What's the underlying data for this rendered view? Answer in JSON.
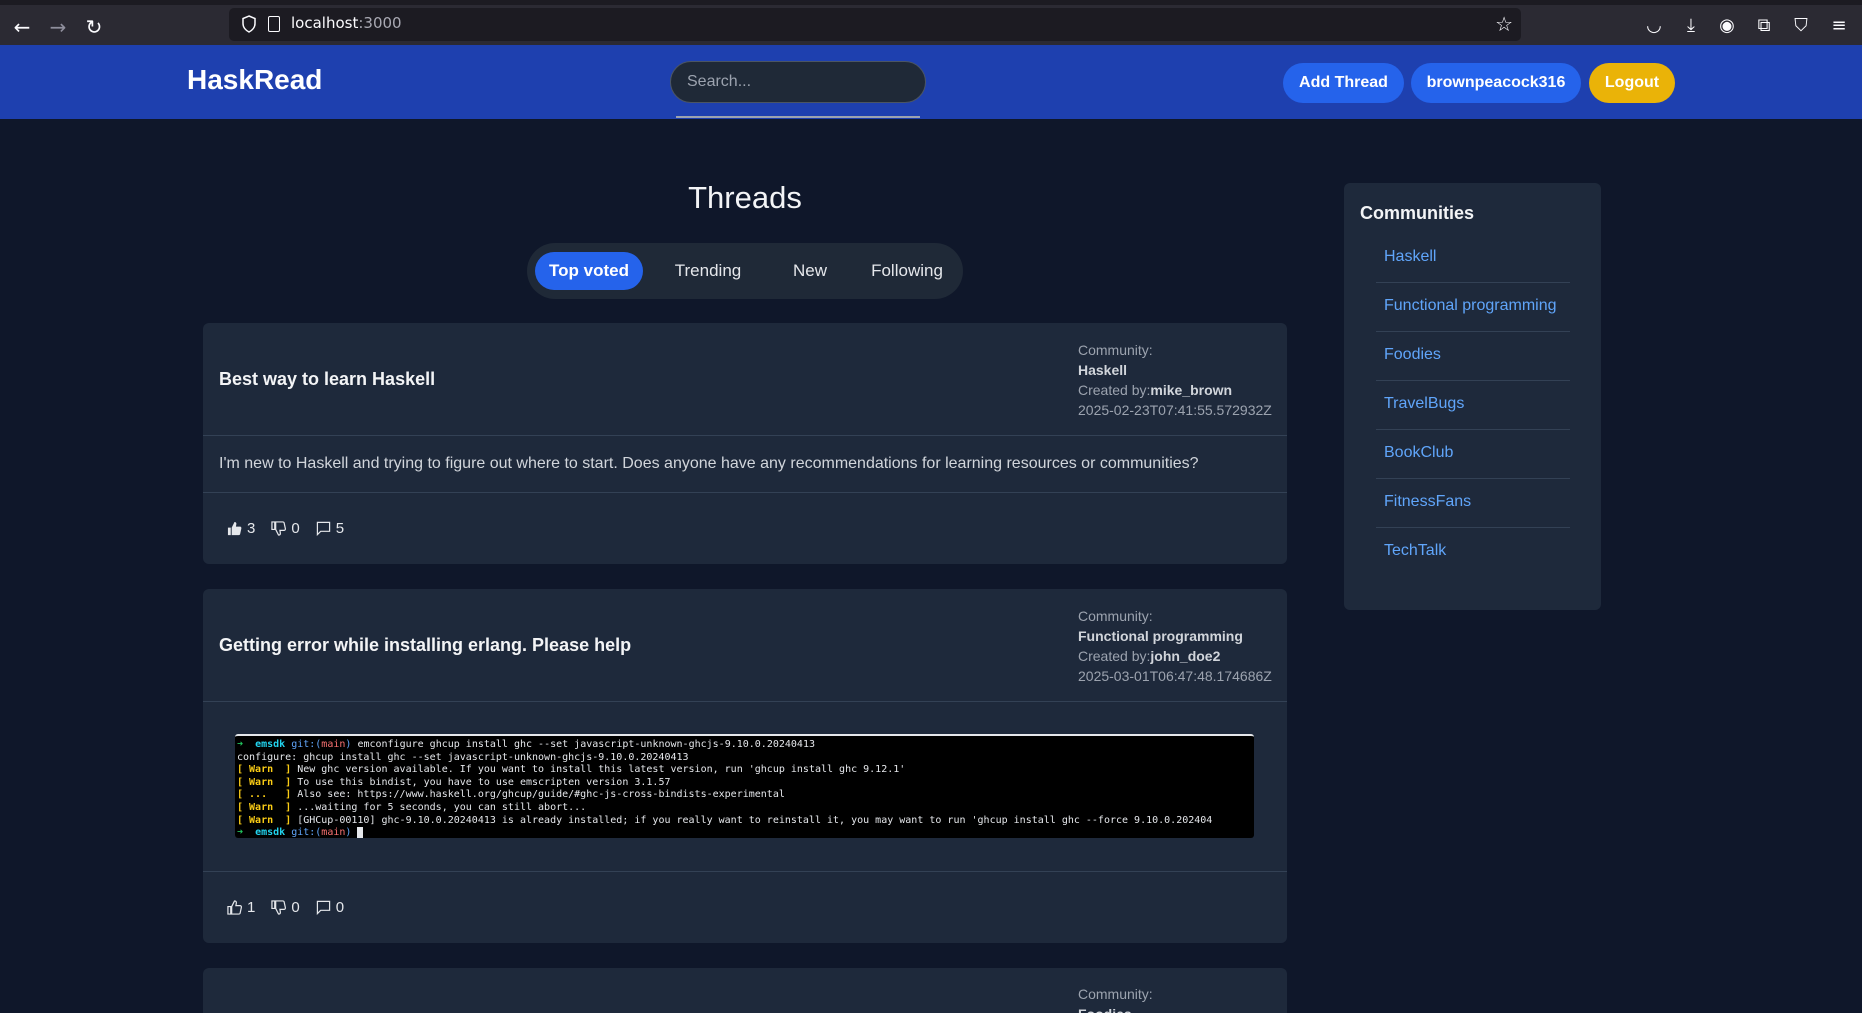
{
  "browser": {
    "url_host": "localhost",
    "url_port": ":3000"
  },
  "header": {
    "logo": "HaskRead",
    "search_placeholder": "Search...",
    "add_thread": "Add Thread",
    "username": "brownpeacock316",
    "logout": "Logout"
  },
  "main": {
    "title": "Threads",
    "tabs": [
      {
        "label": "Top voted",
        "active": true
      },
      {
        "label": "Trending"
      },
      {
        "label": "New"
      },
      {
        "label": "Following"
      }
    ],
    "meta_labels": {
      "community": "Community:",
      "created_by": "Created by:"
    },
    "threads": [
      {
        "title": "Best way to learn Haskell",
        "community": "Haskell",
        "author": "mike_brown",
        "timestamp": "2025-02-23T07:41:55.572932Z",
        "body": "I'm new to Haskell and trying to figure out where to start. Does anyone have any recommendations for learning resources or communities?",
        "upvotes": "3",
        "downvotes": "0",
        "comments": "5"
      },
      {
        "title": "Getting error while installing erlang. Please help",
        "community": "Functional programming",
        "author": "john_doe2",
        "timestamp": "2025-03-01T06:47:48.174686Z",
        "terminal": [
          {
            "prompt": "➜  ",
            "dir": "emsdk ",
            "git": "git:(",
            "branch": "main",
            "close": ") ",
            "text": "emconfigure ghcup install ghc --set javascript-unknown-ghcjs-9.10.0.20240413"
          },
          {
            "text": "configure: ghcup install ghc --set javascript-unknown-ghcjs-9.10.0.20240413"
          },
          {
            "tag": "[ Warn  ]",
            "text": " New ghc version available. If you want to install this latest version, run 'ghcup install ghc 9.12.1'"
          },
          {
            "tag": "[ Warn  ]",
            "text": " To use this bindist, you have to use emscripten version 3.1.57"
          },
          {
            "tag": "[ ...   ]",
            "text": " Also see: https://www.haskell.org/ghcup/guide/#ghc-js-cross-bindists-experimental"
          },
          {
            "tag": "[ Warn  ]",
            "text": " ...waiting for 5 seconds, you can still abort..."
          },
          {
            "tag": "[ Warn  ]",
            "text": " [GHCup-00110] ghc-9.10.0.20240413 is already installed; if you really want to reinstall it, you may want to run 'ghcup install ghc --force 9.10.0.202404"
          },
          {
            "prompt": "➜  ",
            "dir": "emsdk ",
            "git": "git:(",
            "branch": "main",
            "close": ") ",
            "text": ""
          }
        ],
        "upvotes": "1",
        "downvotes": "0",
        "comments": "0"
      },
      {
        "community": "Foodies"
      }
    ]
  },
  "sidebar": {
    "title": "Communities",
    "items": [
      "Haskell",
      "Functional programming",
      "Foodies",
      "TravelBugs",
      "BookClub",
      "FitnessFans",
      "TechTalk"
    ]
  }
}
